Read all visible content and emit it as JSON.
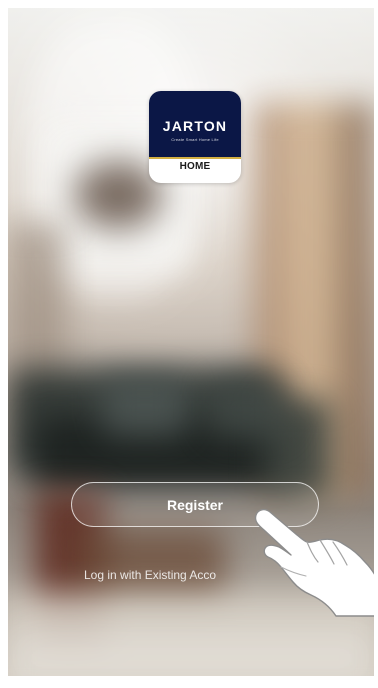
{
  "app": {
    "logo_brand": "JARTON",
    "logo_small": "Create Smart Home Life",
    "logo_home": "HOME"
  },
  "actions": {
    "register_label": "Register",
    "login_link": "Log in with Existing Acco"
  },
  "icons": {
    "pointer": "hand-pointer-icon"
  },
  "colors": {
    "logo_navy": "#0b1746",
    "logo_gold": "#d4b043"
  }
}
